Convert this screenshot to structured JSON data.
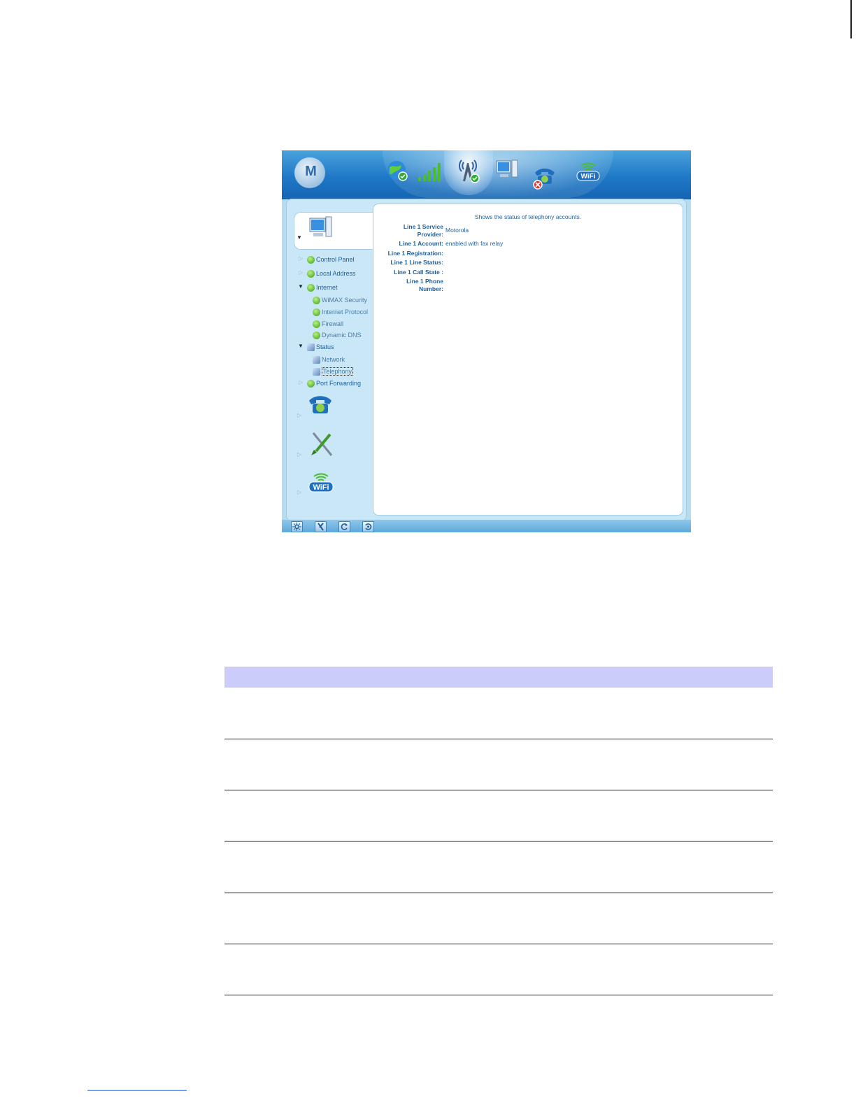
{
  "window": {
    "logo": "M",
    "header_icons": [
      "internet-globe-icon",
      "signal-bars-icon",
      "wimax-tower-icon",
      "computer-icon",
      "telephone-icon",
      "wifi-icon"
    ]
  },
  "sidebar": {
    "sections": [
      "computer-icon",
      "telephone-icon",
      "tools-icon",
      "wifi-icon"
    ],
    "tree": [
      {
        "label": "Control Panel",
        "level": 0,
        "expanded": false
      },
      {
        "label": "Local Address",
        "level": 0,
        "expanded": false
      },
      {
        "label": "Internet",
        "level": 0,
        "expanded": true
      },
      {
        "label": "WiMAX Security",
        "level": 1
      },
      {
        "label": "Internet Protocol",
        "level": 1
      },
      {
        "label": "Firewall",
        "level": 1
      },
      {
        "label": "Dynamic DNS",
        "level": 1
      },
      {
        "label": "Status",
        "level": 0,
        "expanded": true
      },
      {
        "label": "Network",
        "level": 1
      },
      {
        "label": "Telephony",
        "level": 1,
        "selected": true
      },
      {
        "label": "Port Forwarding",
        "level": 0,
        "expanded": false
      }
    ]
  },
  "content": {
    "caption": "Shows the status of telephony accounts.",
    "fields": [
      {
        "label_line1": "Line 1 Service",
        "label_line2": "Provider:",
        "value": "Motorola"
      },
      {
        "label_line1": "Line 1 Account:",
        "label_line2": "",
        "value": "enabled with fax relay"
      },
      {
        "label_line1": "Line 1 Registration:",
        "label_line2": "",
        "value": ""
      },
      {
        "label_line1": "Line 1 Line Status:",
        "label_line2": "",
        "value": ""
      },
      {
        "label_line1": "Line 1 Call State :",
        "label_line2": "",
        "value": ""
      },
      {
        "label_line1": "Line 1 Phone",
        "label_line2": "Number:",
        "value": ""
      }
    ]
  },
  "footer_buttons": [
    "settings-icon",
    "tools-icon",
    "refresh-icon",
    "reboot-icon"
  ],
  "colors": {
    "header_blue": "#1f78c6",
    "panel_blue": "#c9e7f6",
    "text_blue": "#1f5f9a",
    "table_header": "#ccccfb"
  }
}
